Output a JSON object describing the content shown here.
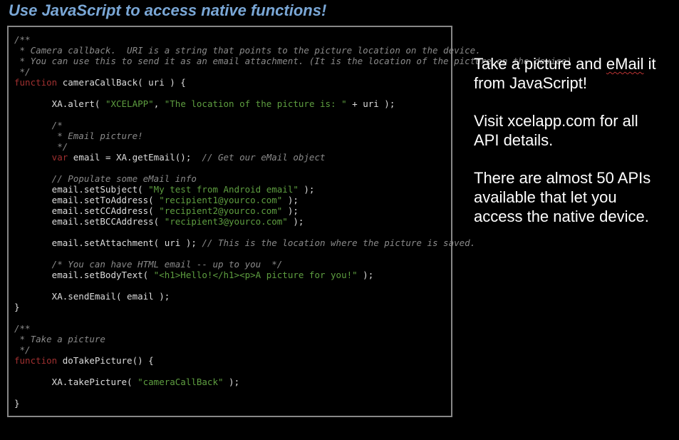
{
  "heading": "Use JavaScript to access native functions!",
  "side": {
    "p1_a": "Take a picture and ",
    "p1_squiggle": "eMail",
    "p1_b": " it from JavaScript!",
    "p2": "Visit xcelapp.com for all API details.",
    "p3": "There are almost 50 APIs available that let you access the native device."
  },
  "code": {
    "blockcomment1_l1": "/**",
    "blockcomment1_l2": " * Camera callback.  URI is a string that points to the picture location on the device.",
    "blockcomment1_l3": " * You can use this to send it as an email attachment. (It is the location of the picture on the device)",
    "blockcomment1_l4": " */",
    "fn1_kw": "function",
    "fn1_name": " cameraCallBack( uri ) {",
    "alert_obj": "       XA",
    "alert_dot": ".alert( ",
    "alert_s1": "\"XCELAPP\"",
    "alert_comma": ", ",
    "alert_s2": "\"The location of the picture is: \"",
    "alert_tail": " + uri );",
    "emailcomment_l1": "       /*",
    "emailcomment_l2": "        * Email picture!",
    "emailcomment_l3": "        */",
    "var_kw": "       var",
    "var_rest": " email = XA.getEmail();  ",
    "var_comment": "// Get our eMail object",
    "pop_comment": "       // Populate some eMail info",
    "subj_a": "       email.setSubject( ",
    "subj_s": "\"My test from Android email\"",
    "subj_b": " );",
    "to_a": "       email.setToAddress( ",
    "to_s": "\"recipient1@yourco.com\"",
    "to_b": " );",
    "cc_a": "       email.setCCAddress( ",
    "cc_s": "\"recipient2@yourco.com\"",
    "cc_b": " );",
    "bcc_a": "       email.setBCCAddress( ",
    "bcc_s": "\"recipient3@yourco.com\"",
    "bcc_b": " );",
    "att_a": "       email.setAttachment( uri ); ",
    "att_c": "// This is the location where the picture is saved.",
    "html_comment": "       /* You can have HTML email -- up to you  */",
    "body_a": "       email.setBodyText( ",
    "body_s": "\"<h1>Hello!</h1><p>A picture for you!\"",
    "body_b": " );",
    "send_a": "       XA.sendEmail( email );",
    "fn1_close": "}",
    "blockcomment2_l1": "/**",
    "blockcomment2_l2": " * Take a picture",
    "blockcomment2_l3": " */",
    "fn2_kw": "function",
    "fn2_name": " doTakePicture() {",
    "take_a": "       XA.takePicture( ",
    "take_s": "\"cameraCallBack\"",
    "take_b": " );",
    "fn2_close": "}"
  }
}
